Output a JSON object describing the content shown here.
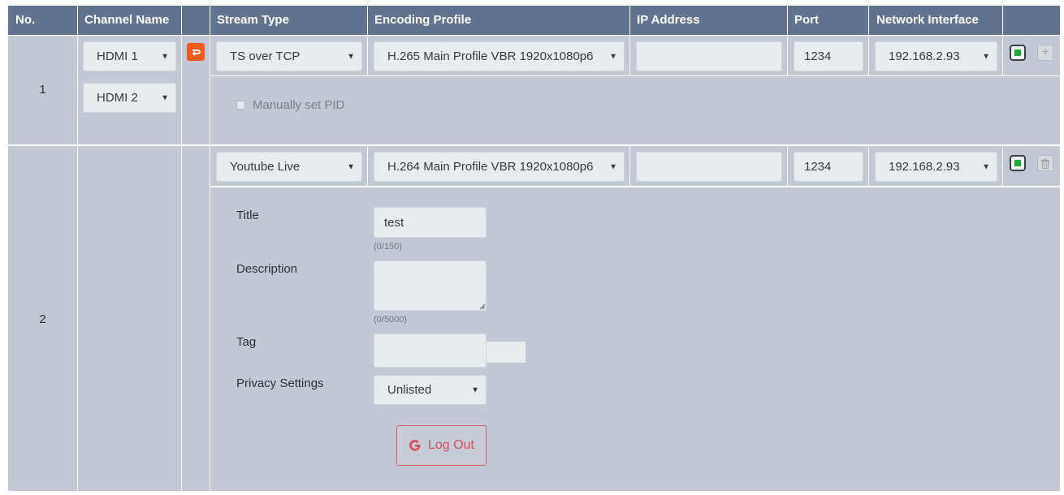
{
  "header": {
    "no": "No.",
    "channel_name": "Channel Name",
    "stream_type": "Stream Type",
    "encoding_profile": "Encoding Profile",
    "ip_address": "IP Address",
    "port": "Port",
    "network_interface": "Network Interface"
  },
  "rows": [
    {
      "number": "1",
      "channel_names": [
        "HDMI 1",
        "HDMI 2"
      ],
      "stream_type": "TS over TCP",
      "encoding_profile": "H.265 Main Profile VBR 1920x1080p6",
      "ip_address": "",
      "port": "1234",
      "network_interface": "192.168.2.93",
      "manual_pid_label": "Manually set PID",
      "manual_pid_checked": false
    },
    {
      "number": "2",
      "stream_type": "Youtube Live",
      "encoding_profile": "H.264 Main Profile VBR 1920x1080p6",
      "ip_address": "",
      "port": "1234",
      "network_interface": "192.168.2.93",
      "youtube": {
        "title_label": "Title",
        "title_value": "test",
        "title_counter": "(0/150)",
        "description_label": "Description",
        "description_value": "",
        "description_counter": "(0/5000)",
        "tag_label": "Tag",
        "tag_value": "",
        "privacy_label": "Privacy Settings",
        "privacy_value": "Unlisted",
        "logout_label": "Log Out"
      }
    }
  ],
  "icons": {
    "dropdown": "caret-down-icon",
    "refresh": "swap-icon",
    "stop": "stop-icon",
    "add": "plus-icon",
    "delete": "trash-icon",
    "google": "google-g-icon"
  },
  "colors": {
    "header_bg": "#627390",
    "cell_bg": "#c3c9d4",
    "stop_green": "#1aaa3a",
    "refresh_orange": "#f15a1f",
    "logout_red": "#d3505e"
  }
}
